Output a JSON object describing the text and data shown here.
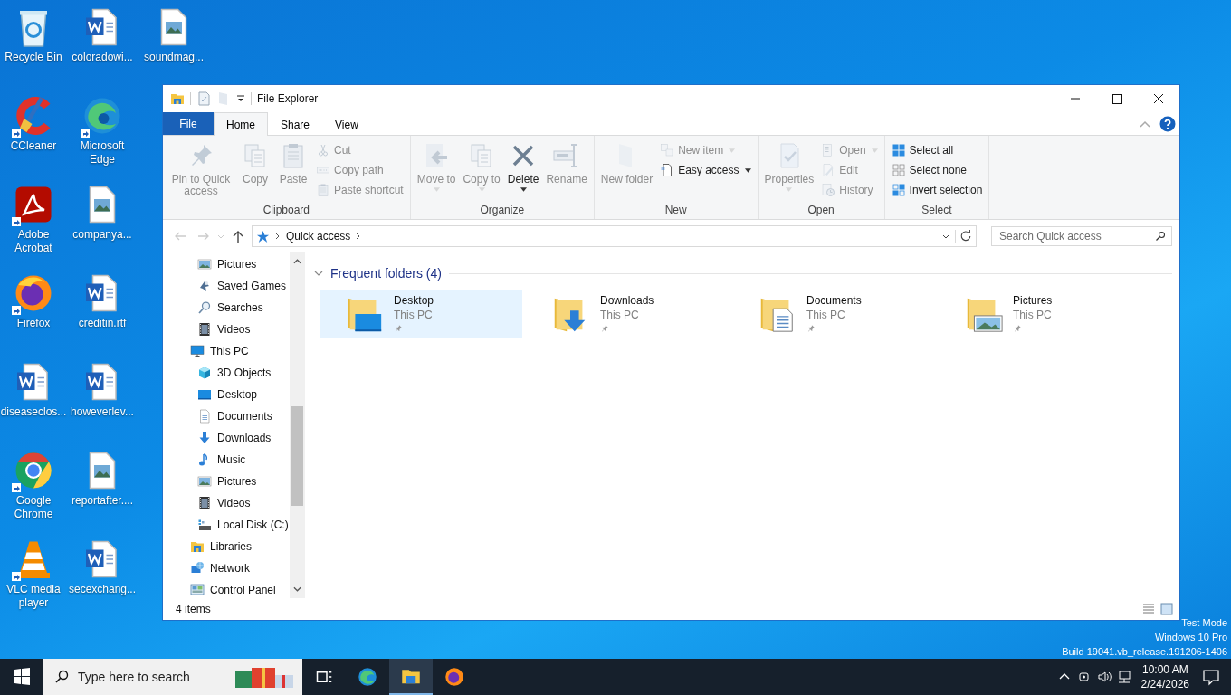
{
  "desktop": {
    "icons": [
      {
        "label": "Recycle Bin",
        "shortcut": false
      },
      {
        "label": "CCleaner",
        "shortcut": true
      },
      {
        "label": "Adobe Acrobat",
        "shortcut": true
      },
      {
        "label": "Firefox",
        "shortcut": true
      },
      {
        "label": "diseaseclos...",
        "shortcut": false
      },
      {
        "label": "Google Chrome",
        "shortcut": true
      },
      {
        "label": "VLC media player",
        "shortcut": true
      },
      {
        "label": "coloradowi...",
        "shortcut": false
      },
      {
        "label": "Microsoft Edge",
        "shortcut": true
      },
      {
        "label": "companya...",
        "shortcut": false
      },
      {
        "label": "creditin.rtf",
        "shortcut": false
      },
      {
        "label": "howeverlev...",
        "shortcut": false
      },
      {
        "label": "reportafter....",
        "shortcut": false
      },
      {
        "label": "secexchang...",
        "shortcut": false
      },
      {
        "label": "soundmag...",
        "shortcut": false
      }
    ],
    "system_text": [
      "Test Mode",
      "Windows 10 Pro",
      "Build 19041.vb_release.191206-1406"
    ]
  },
  "window": {
    "title": "File Explorer",
    "tabs": [
      {
        "label": "File",
        "kind": "menu",
        "selected": false
      },
      {
        "label": "Home",
        "kind": "tab",
        "selected": true
      },
      {
        "label": "Share",
        "kind": "tab",
        "selected": false
      },
      {
        "label": "View",
        "kind": "tab",
        "selected": false
      }
    ],
    "ribbon": {
      "groups": [
        {
          "label": "Clipboard",
          "items": [
            {
              "kind": "large",
              "label": "Pin to Quick access",
              "disabled": true,
              "dropdown": false
            },
            {
              "kind": "large",
              "label": "Copy",
              "disabled": true,
              "dropdown": false
            },
            {
              "kind": "large",
              "label": "Paste",
              "disabled": true,
              "dropdown": false
            },
            {
              "kind": "small",
              "label": "Cut",
              "disabled": true,
              "dropdown": false
            },
            {
              "kind": "small",
              "label": "Copy path",
              "disabled": true,
              "dropdown": false
            },
            {
              "kind": "small",
              "label": "Paste shortcut",
              "disabled": true,
              "dropdown": false
            }
          ]
        },
        {
          "label": "Organize",
          "items": [
            {
              "kind": "large",
              "label": "Move to",
              "disabled": true,
              "dropdown": true
            },
            {
              "kind": "large",
              "label": "Copy to",
              "disabled": true,
              "dropdown": true
            },
            {
              "kind": "large",
              "label": "Delete",
              "disabled": false,
              "dropdown": true
            },
            {
              "kind": "large",
              "label": "Rename",
              "disabled": true,
              "dropdown": false
            }
          ]
        },
        {
          "label": "New",
          "items": [
            {
              "kind": "large",
              "label": "New folder",
              "disabled": true,
              "dropdown": false
            },
            {
              "kind": "small",
              "label": "New item",
              "disabled": true,
              "dropdown": true
            },
            {
              "kind": "small",
              "label": "Easy access",
              "disabled": false,
              "dropdown": true
            }
          ]
        },
        {
          "label": "Open",
          "items": [
            {
              "kind": "large",
              "label": "Properties",
              "disabled": true,
              "dropdown": true
            },
            {
              "kind": "small",
              "label": "Open",
              "disabled": true,
              "dropdown": true
            },
            {
              "kind": "small",
              "label": "Edit",
              "disabled": true,
              "dropdown": false
            },
            {
              "kind": "small",
              "label": "History",
              "disabled": true,
              "dropdown": false
            }
          ]
        },
        {
          "label": "Select",
          "items": [
            {
              "kind": "small",
              "label": "Select all",
              "disabled": false,
              "dropdown": false
            },
            {
              "kind": "small",
              "label": "Select none",
              "disabled": false,
              "dropdown": false
            },
            {
              "kind": "small",
              "label": "Invert selection",
              "disabled": false,
              "dropdown": false
            }
          ]
        }
      ]
    },
    "address": {
      "path": "Quick access"
    },
    "search": {
      "placeholder": "Search Quick access"
    },
    "nav_pane": {
      "scrolled_items": [
        {
          "label": "Pictures"
        },
        {
          "label": "Saved Games"
        },
        {
          "label": "Searches"
        },
        {
          "label": "Videos"
        }
      ],
      "items": [
        {
          "label": "This PC",
          "children": [
            {
              "label": "3D Objects"
            },
            {
              "label": "Desktop"
            },
            {
              "label": "Documents"
            },
            {
              "label": "Downloads"
            },
            {
              "label": "Music"
            },
            {
              "label": "Pictures"
            },
            {
              "label": "Videos"
            },
            {
              "label": "Local Disk (C:)"
            }
          ]
        },
        {
          "label": "Libraries"
        },
        {
          "label": "Network"
        },
        {
          "label": "Control Panel"
        }
      ]
    },
    "section": {
      "title": "Frequent folders (4)",
      "expanded": true
    },
    "folders": [
      {
        "name": "Desktop",
        "location": "This PC",
        "selected": true
      },
      {
        "name": "Downloads",
        "location": "This PC",
        "selected": false
      },
      {
        "name": "Documents",
        "location": "This PC",
        "selected": false
      },
      {
        "name": "Pictures",
        "location": "This PC",
        "selected": false
      }
    ],
    "status_bar": {
      "text": "4 items"
    }
  },
  "taskbar": {
    "search_placeholder": "Type here to search",
    "apps": [
      {
        "selected": false
      },
      {
        "selected": false
      },
      {
        "selected": true
      },
      {
        "selected": false
      }
    ],
    "time": "10:00 AM",
    "date": "2/24/2026"
  }
}
